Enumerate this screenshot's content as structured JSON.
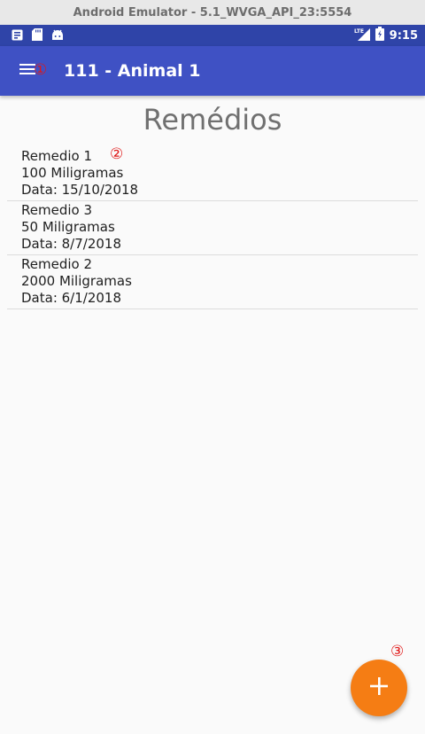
{
  "emulator": {
    "title": "Android Emulator - 5.1_WVGA_API_23:5554"
  },
  "status_bar": {
    "time": "9:15",
    "network": "LTE"
  },
  "app_bar": {
    "title": "111 - Animal 1"
  },
  "page": {
    "title": "Remédios"
  },
  "medicines": [
    {
      "name": "Remedio 1",
      "dose": "100 Miligramas",
      "date": "Data: 15/10/2018"
    },
    {
      "name": "Remedio 3",
      "dose": "50 Miligramas",
      "date": "Data: 8/7/2018"
    },
    {
      "name": "Remedio 2",
      "dose": "2000 Miligramas",
      "date": "Data: 6/1/2018"
    }
  ],
  "annotations": {
    "m1": "①",
    "m2": "②",
    "m3": "③"
  },
  "colors": {
    "status_bar": "#2f44a8",
    "app_bar": "#3f51c4",
    "fab": "#f57d14",
    "annotation": "#e01818"
  }
}
